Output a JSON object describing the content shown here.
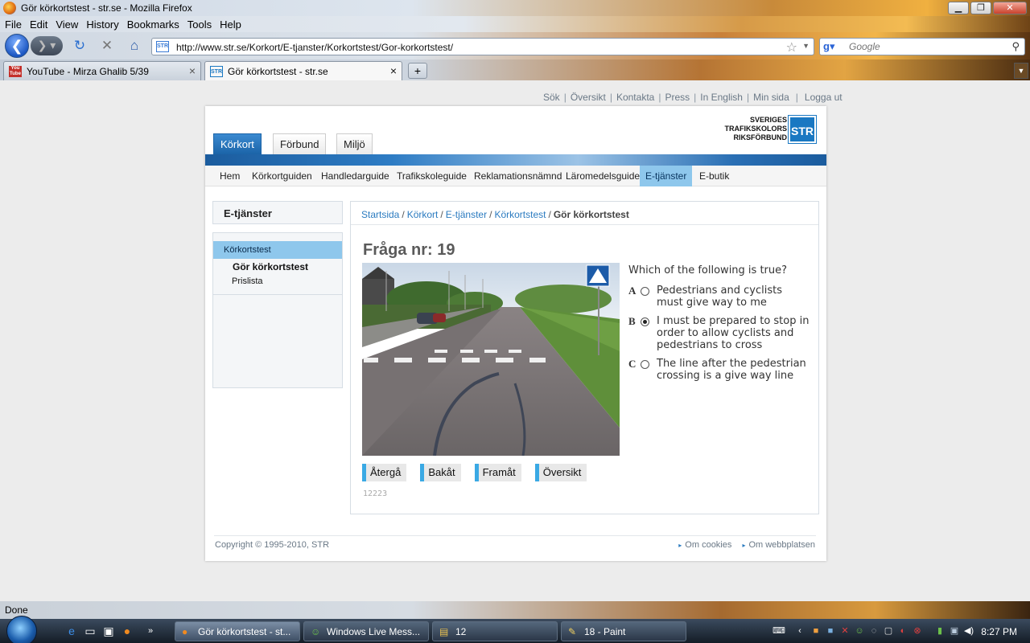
{
  "window": {
    "title": "Gör körkortstest - str.se - Mozilla Firefox",
    "minimize": "▁",
    "maximize": "❐",
    "close": "✕"
  },
  "menu": [
    "File",
    "Edit",
    "View",
    "History",
    "Bookmarks",
    "Tools",
    "Help"
  ],
  "toolbar": {
    "url": "http://www.str.se/Korkort/E-tjanster/Korkortstest/Gor-korkortstest/",
    "site_badge": "STR",
    "search_placeholder": "Google"
  },
  "tabs": [
    {
      "label": "YouTube - Mirza Ghalib 5/39",
      "favicon": "You Tube"
    },
    {
      "label": "Gör körkortstest - str.se",
      "favicon": "STR"
    }
  ],
  "top_links": [
    "Sök",
    "Översikt",
    "Kontakta",
    "Press",
    "In English",
    "Min sida",
    "Logga ut"
  ],
  "logo": {
    "line1": "SVERIGES",
    "line2": "TRAFIKSKOLORS",
    "line3": "RIKSFÖRBUND",
    "mark": "STR"
  },
  "main_tabs": [
    "Körkort",
    "Förbund",
    "Miljö"
  ],
  "sub_nav": [
    "Hem",
    "Körkortguiden",
    "Handledarguide",
    "Trafikskoleguide",
    "Reklamationsnämnd",
    "Läromedelsguide",
    "E-tjänster",
    "E-butik"
  ],
  "sidebar": {
    "title": "E-tjänster",
    "section": "Körkortstest",
    "items": [
      "Gör körkortstest",
      "Prislista"
    ]
  },
  "breadcrumb": {
    "links": [
      "Startsida",
      "Körkort",
      "E-tjänster",
      "Körkortstest"
    ],
    "current": "Gör körkortstest",
    "separator": "/"
  },
  "quiz": {
    "title": "Fråga nr: 19",
    "question": "Which of the following is true?",
    "selected": "B",
    "options": [
      {
        "letter": "A",
        "text": "Pedestrians and cyclists must give way to me"
      },
      {
        "letter": "B",
        "text": "I must be prepared to stop in order to allow cyclists and pedestrians to cross"
      },
      {
        "letter": "C",
        "text": "The line after the pedestrian crossing is a give way line"
      }
    ],
    "buttons": [
      "Återgå",
      "Bakåt",
      "Framåt",
      "Översikt"
    ],
    "id": "12223"
  },
  "footer": {
    "copyright": "Copyright © 1995-2010, STR",
    "links": [
      "Om cookies",
      "Om webbplatsen"
    ]
  },
  "status": "Done",
  "taskbar": {
    "items": [
      {
        "label": "Gör körkortstest - st...",
        "active": true
      },
      {
        "label": "Windows Live Mess...",
        "active": false
      },
      {
        "label": "12",
        "active": false
      },
      {
        "label": "18 - Paint",
        "active": false
      }
    ],
    "clock": "8:27 PM"
  }
}
